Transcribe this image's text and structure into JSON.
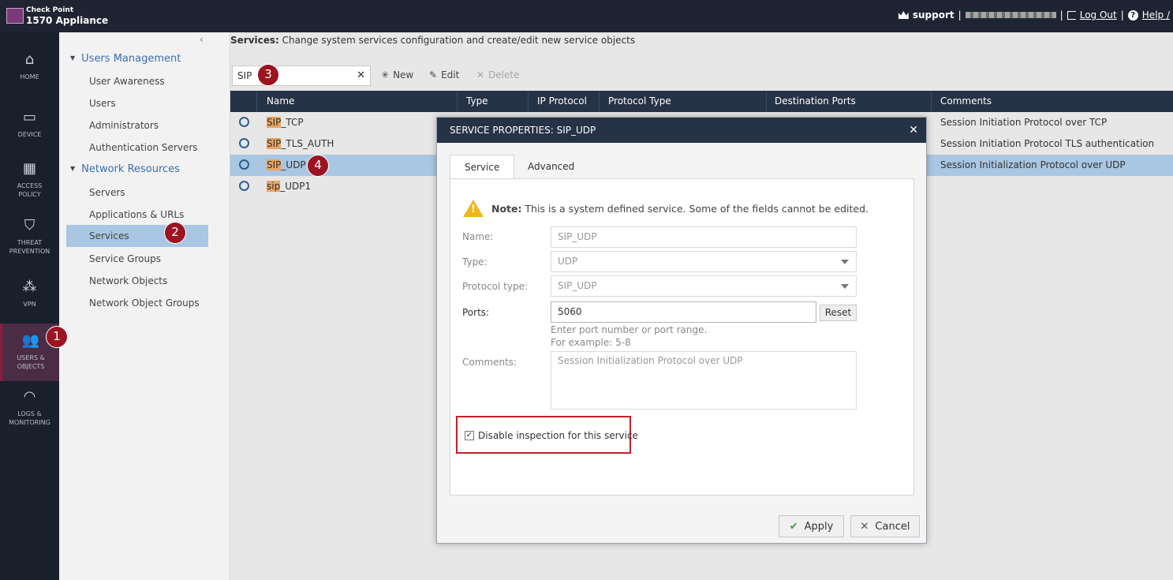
{
  "app": {
    "brand_small": "Check Point",
    "brand_big": "1570 Appliance"
  },
  "topbar": {
    "user": "support",
    "sep": "|",
    "logout": "Log Out",
    "help": "Help /",
    "help_glyph": "?"
  },
  "nav": [
    {
      "label1": "HOME",
      "label2": "",
      "glyph": "⌂"
    },
    {
      "label1": "DEVICE",
      "label2": "",
      "glyph": "▭"
    },
    {
      "label1": "ACCESS",
      "label2": "POLICY",
      "glyph": "▦"
    },
    {
      "label1": "THREAT",
      "label2": "PREVENTION",
      "glyph": "⛉"
    },
    {
      "label1": "VPN",
      "label2": "",
      "glyph": "⁂"
    },
    {
      "label1": "USERS &",
      "label2": "OBJECTS",
      "glyph": "👥"
    },
    {
      "label1": "LOGS &",
      "label2": "MONITORING",
      "glyph": "◠"
    }
  ],
  "sidebar": {
    "collapse_glyph": "‹",
    "tri_glyph": "▼",
    "groups": [
      {
        "title": "Users Management",
        "items": [
          "User Awareness",
          "Users",
          "Administrators",
          "Authentication Servers"
        ]
      },
      {
        "title": "Network Resources",
        "items": [
          "Servers",
          "Applications & URLs",
          "Services",
          "Service Groups",
          "Network Objects",
          "Network Object Groups"
        ]
      }
    ]
  },
  "main": {
    "desc_bold": "Services:",
    "desc_rest": " Change system services configuration and create/edit new service objects",
    "search_value": "SIP",
    "search_clear": "✕",
    "toolbar": {
      "new": "New",
      "edit": "Edit",
      "delete": "Delete",
      "new_glyph": "✳",
      "edit_glyph": "✎",
      "delete_glyph": "✕"
    },
    "columns": [
      "Name",
      "Type",
      "IP Protocol",
      "Protocol Type",
      "Destination Ports",
      "Comments"
    ],
    "rows": [
      {
        "hl": "SIP",
        "rest": "_TCP",
        "comment": "Session Initiation Protocol over TCP"
      },
      {
        "hl": "SIP",
        "rest": "_TLS_AUTH",
        "comment": "Session Initiation Protocol TLS authentication"
      },
      {
        "hl": "SIP",
        "rest": "_UDP",
        "comment": "Session Initialization Protocol over UDP"
      },
      {
        "hl": "sip",
        "rest": "_UDP1",
        "comment": ""
      }
    ]
  },
  "badges": [
    "1",
    "2",
    "3",
    "4"
  ],
  "dialog": {
    "title": "SERVICE PROPERTIES: SIP_UDP",
    "close": "✕",
    "tabs": [
      "Service",
      "Advanced"
    ],
    "note_bold": "Note:",
    "note_rest": " This is a system defined service. Some of the fields cannot be edited.",
    "warn_glyph": "!",
    "name_label": "Name:",
    "name_value": "SIP_UDP",
    "type_label": "Type:",
    "type_value": "UDP",
    "ptype_label": "Protocol type:",
    "ptype_value": "SIP_UDP",
    "ports_label": "Ports:",
    "ports_value": "5060",
    "reset": "Reset",
    "hint1": "Enter port number or port range.",
    "hint2": "For example: 5-8",
    "comments_label": "Comments:",
    "comments_value": "Session Initialization Protocol over UDP",
    "checkbox_label": "Disable inspection for this service",
    "checkbox_checked": true,
    "check_glyph": "✓",
    "apply": "Apply",
    "cancel": "Cancel",
    "apply_glyph": "✔",
    "cancel_glyph": "✕"
  }
}
